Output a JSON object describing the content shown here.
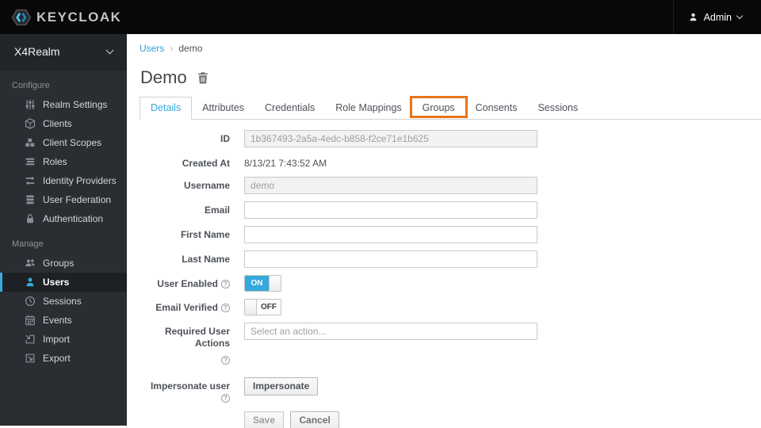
{
  "topbar": {
    "brand": "KEYCLOAK",
    "user_menu": {
      "label": "Admin",
      "icon": "user-icon"
    }
  },
  "sidebar": {
    "realm": "X4Realm",
    "sections": [
      {
        "label": "Configure",
        "items": [
          {
            "label": "Realm Settings",
            "icon": "sliders-icon"
          },
          {
            "label": "Clients",
            "icon": "cube-icon"
          },
          {
            "label": "Client Scopes",
            "icon": "cubes-icon"
          },
          {
            "label": "Roles",
            "icon": "list-icon"
          },
          {
            "label": "Identity Providers",
            "icon": "exchange-arrows-icon"
          },
          {
            "label": "User Federation",
            "icon": "database-icon"
          },
          {
            "label": "Authentication",
            "icon": "lock-icon"
          }
        ]
      },
      {
        "label": "Manage",
        "items": [
          {
            "label": "Groups",
            "icon": "users-icon"
          },
          {
            "label": "Users",
            "icon": "user-icon",
            "active": true
          },
          {
            "label": "Sessions",
            "icon": "clock-icon"
          },
          {
            "label": "Events",
            "icon": "calendar-icon"
          },
          {
            "label": "Import",
            "icon": "import-icon"
          },
          {
            "label": "Export",
            "icon": "export-icon"
          }
        ]
      }
    ]
  },
  "breadcrumb": {
    "items": [
      "Users",
      "demo"
    ],
    "separator": "›"
  },
  "page": {
    "title": "Demo",
    "delete_icon": "trash-icon"
  },
  "tabs": [
    {
      "label": "Details",
      "active": true
    },
    {
      "label": "Attributes"
    },
    {
      "label": "Credentials"
    },
    {
      "label": "Role Mappings"
    },
    {
      "label": "Groups",
      "annotated": true
    },
    {
      "label": "Consents"
    },
    {
      "label": "Sessions"
    }
  ],
  "form": {
    "id": {
      "label": "ID",
      "value": "1b367493-2a5a-4edc-b858-f2ce71e1b625"
    },
    "created_at": {
      "label": "Created At",
      "value": "8/13/21 7:43:52 AM"
    },
    "username": {
      "label": "Username",
      "value": "demo"
    },
    "email": {
      "label": "Email",
      "value": ""
    },
    "first_name": {
      "label": "First Name",
      "value": ""
    },
    "last_name": {
      "label": "Last Name",
      "value": ""
    },
    "user_enabled": {
      "label": "User Enabled",
      "state": "ON"
    },
    "email_verified": {
      "label": "Email Verified",
      "state": "OFF"
    },
    "required_actions": {
      "label": "Required User Actions",
      "placeholder": "Select an action..."
    },
    "impersonate": {
      "label": "Impersonate user",
      "button_label": "Impersonate"
    },
    "actions": {
      "save": "Save",
      "cancel": "Cancel"
    }
  },
  "glyphs": {
    "help": "?"
  },
  "colors": {
    "accent_blue": "#39a9dc",
    "toggle_on": "#35a8dc",
    "annotation_orange": "#e8731a",
    "topbar_bg": "#080808",
    "sidebar_bg": "#292e33"
  }
}
